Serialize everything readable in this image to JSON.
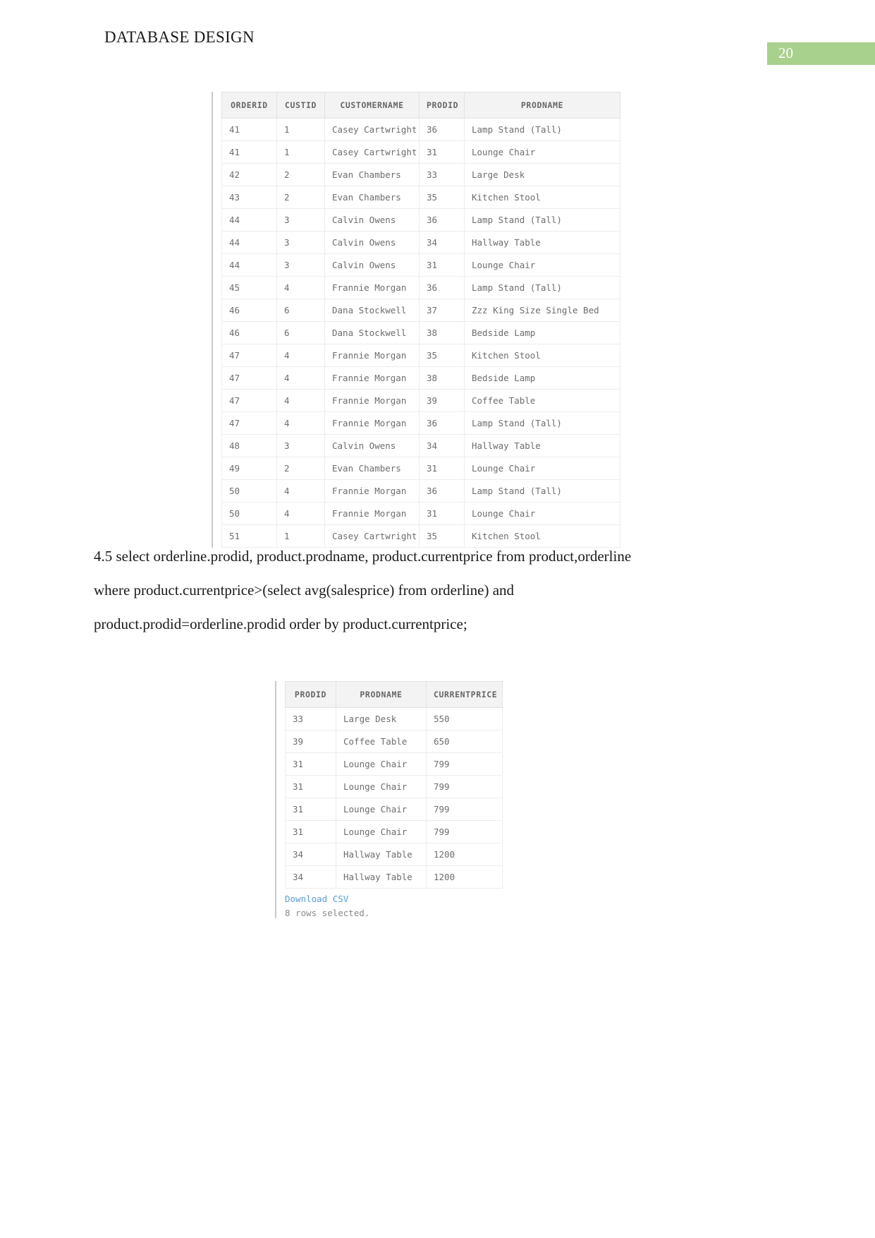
{
  "header": {
    "document_title": "DATABASE DESIGN",
    "page_number": "20",
    "badge_color": "#a9d18e"
  },
  "query_text": {
    "line1": "4.5 select orderline.prodid, product.prodname, product.currentprice from product,orderline",
    "line2": "where product.currentprice>(select avg(salesprice) from orderline) and",
    "line3": "product.prodid=orderline.prodid order by product.currentprice;"
  },
  "table1": {
    "columns": [
      "ORDERID",
      "CUSTID",
      "CUSTOMERNAME",
      "PRODID",
      "PRODNAME"
    ],
    "rows": [
      [
        "41",
        "1",
        "Casey Cartwright",
        "36",
        "Lamp Stand (Tall)"
      ],
      [
        "41",
        "1",
        "Casey Cartwright",
        "31",
        "Lounge Chair"
      ],
      [
        "42",
        "2",
        "Evan Chambers",
        "33",
        "Large Desk"
      ],
      [
        "43",
        "2",
        "Evan Chambers",
        "35",
        "Kitchen Stool"
      ],
      [
        "44",
        "3",
        "Calvin Owens",
        "36",
        "Lamp Stand (Tall)"
      ],
      [
        "44",
        "3",
        "Calvin Owens",
        "34",
        "Hallway Table"
      ],
      [
        "44",
        "3",
        "Calvin Owens",
        "31",
        "Lounge Chair"
      ],
      [
        "45",
        "4",
        "Frannie Morgan",
        "36",
        "Lamp Stand (Tall)"
      ],
      [
        "46",
        "6",
        "Dana Stockwell",
        "37",
        "Zzz King Size Single Bed"
      ],
      [
        "46",
        "6",
        "Dana Stockwell",
        "38",
        "Bedside Lamp"
      ],
      [
        "47",
        "4",
        "Frannie Morgan",
        "35",
        "Kitchen Stool"
      ],
      [
        "47",
        "4",
        "Frannie Morgan",
        "38",
        "Bedside Lamp"
      ],
      [
        "47",
        "4",
        "Frannie Morgan",
        "39",
        "Coffee Table"
      ],
      [
        "47",
        "4",
        "Frannie Morgan",
        "36",
        "Lamp Stand (Tall)"
      ],
      [
        "48",
        "3",
        "Calvin Owens",
        "34",
        "Hallway Table"
      ],
      [
        "49",
        "2",
        "Evan Chambers",
        "31",
        "Lounge Chair"
      ],
      [
        "50",
        "4",
        "Frannie Morgan",
        "36",
        "Lamp Stand (Tall)"
      ],
      [
        "50",
        "4",
        "Frannie Morgan",
        "31",
        "Lounge Chair"
      ],
      [
        "51",
        "1",
        "Casey Cartwright",
        "35",
        "Kitchen Stool"
      ]
    ]
  },
  "table2": {
    "columns": [
      "PRODID",
      "PRODNAME",
      "CURRENTPRICE"
    ],
    "rows": [
      [
        "33",
        "Large Desk",
        "550"
      ],
      [
        "39",
        "Coffee Table",
        "650"
      ],
      [
        "31",
        "Lounge Chair",
        "799"
      ],
      [
        "31",
        "Lounge Chair",
        "799"
      ],
      [
        "31",
        "Lounge Chair",
        "799"
      ],
      [
        "31",
        "Lounge Chair",
        "799"
      ],
      [
        "34",
        "Hallway Table",
        "1200"
      ],
      [
        "34",
        "Hallway Table",
        "1200"
      ]
    ],
    "download_label": "Download CSV",
    "rows_selected": "8 rows selected."
  }
}
